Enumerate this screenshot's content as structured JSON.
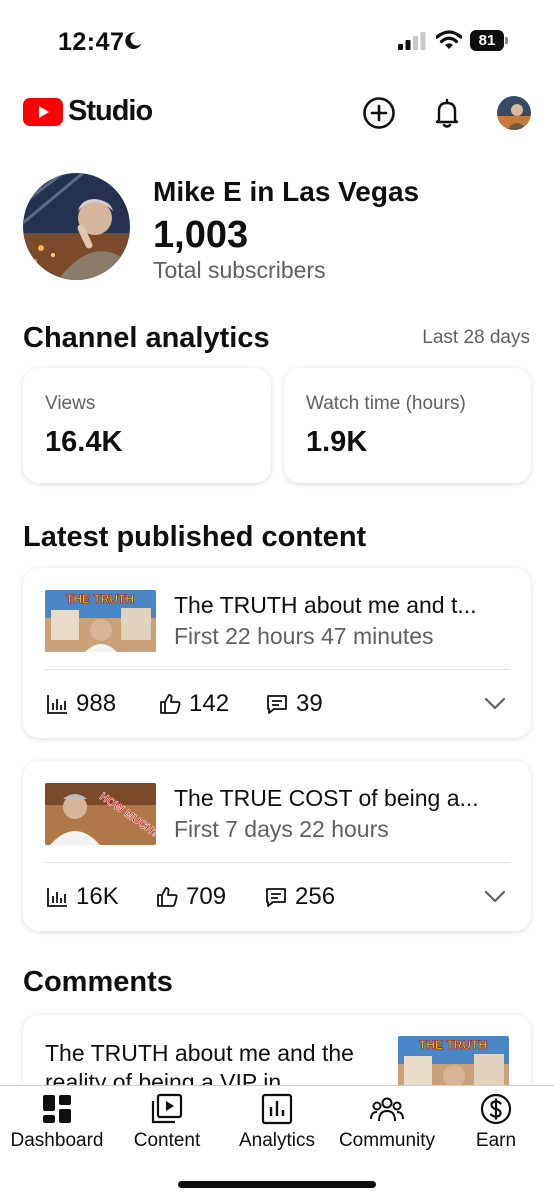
{
  "status_bar": {
    "time": "12:47",
    "battery": "81"
  },
  "header": {
    "app_name": "Studio",
    "brand_color": "#ff0000"
  },
  "channel": {
    "name": "Mike E in Las Vegas",
    "subscribers": "1,003",
    "subscribers_label": "Total subscribers"
  },
  "analytics": {
    "title": "Channel analytics",
    "period": "Last 28 days",
    "metrics": [
      {
        "label": "Views",
        "value": "16.4K"
      },
      {
        "label": "Watch time (hours)",
        "value": "1.9K"
      }
    ]
  },
  "latest": {
    "title": "Latest published content",
    "videos": [
      {
        "title": "The TRUTH about me and t...",
        "subtitle": "First 22 hours 47 minutes",
        "thumb_text": "THE TRUTH",
        "views": "988",
        "likes": "142",
        "comments": "39"
      },
      {
        "title": "The TRUE COST of being a...",
        "subtitle": "First 7 days 22 hours",
        "thumb_text": "HOW MUCH?!",
        "views": "16K",
        "likes": "709",
        "comments": "256"
      }
    ]
  },
  "comments": {
    "title": "Comments",
    "items": [
      {
        "text": "The TRUTH about me and the reality of being a VIP in",
        "thumb_text": "THE TRUTH"
      }
    ]
  },
  "nav": {
    "items": [
      {
        "label": "Dashboard",
        "icon": "dashboard-icon",
        "active": true
      },
      {
        "label": "Content",
        "icon": "content-icon"
      },
      {
        "label": "Analytics",
        "icon": "analytics-icon"
      },
      {
        "label": "Community",
        "icon": "community-icon"
      },
      {
        "label": "Earn",
        "icon": "earn-icon"
      }
    ]
  }
}
